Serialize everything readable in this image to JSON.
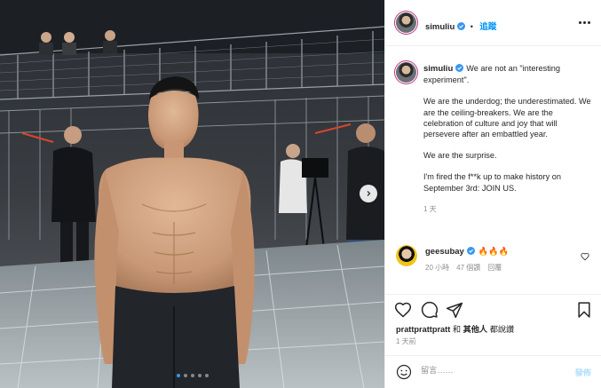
{
  "header": {
    "username": "simuliu",
    "follow_label": "追蹤",
    "more_icon": "more-options-icon"
  },
  "caption": {
    "username": "simuliu",
    "paragraphs": [
      "We are not an \"interesting experiment\".",
      "We are the underdog; the underestimated. We are the ceiling-breakers. We are the celebration of culture and joy that will persevere after an embattled year.",
      "We are the surprise.",
      "I'm fired the f**k up to make history on September 3rd: JOIN US."
    ],
    "time": "1 天"
  },
  "comment": {
    "username": "geesubay",
    "text": "🔥🔥🔥",
    "time": "20 小時",
    "likes": "47 個讚",
    "reply_label": "回覆"
  },
  "actions": {
    "like_icon": "heart-icon",
    "comment_icon": "comment-icon",
    "share_icon": "share-icon",
    "save_icon": "bookmark-icon"
  },
  "likes_line": {
    "user": "prattprattpratt",
    "connector": "和",
    "others": "其他人",
    "suffix": "都說讚"
  },
  "post_age": "1 天前",
  "comment_box": {
    "placeholder": "留言……",
    "post_label": "發佈",
    "emoji_icon": "smiley-icon"
  },
  "carousel": {
    "total_slides": 5,
    "active_slide": 1,
    "next_icon": "chevron-right-icon"
  },
  "colors": {
    "link_blue": "#0095f6",
    "disabled_blue": "#b2dffc",
    "verified_blue": "#3897f0",
    "muted_text": "#8e8e8e",
    "divider": "#efefef"
  }
}
